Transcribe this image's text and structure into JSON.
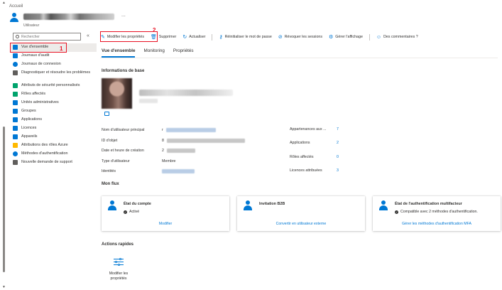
{
  "breadcrumb": "Accueil",
  "header": {
    "subtitle": "Utilisateur",
    "more": "..."
  },
  "search": {
    "placeholder": "Rechercher",
    "collapse": "«"
  },
  "sidebar": {
    "items": [
      {
        "label": "Vue d'ensemble",
        "color": "#0078d4"
      },
      {
        "label": "Journaux d'audit",
        "color": "#0078d4"
      },
      {
        "label": "Journaux de connexion",
        "color": "#0078d4"
      },
      {
        "label": "Diagnostiquer et résoudre les problèmes",
        "color": "#0078d4"
      },
      {
        "label": "Attributs de sécurité personnalisés",
        "color": "#0078d4"
      },
      {
        "label": "Rôles affectés",
        "color": "#0078d4"
      },
      {
        "label": "Unités administratives",
        "color": "#0078d4"
      },
      {
        "label": "Groupes",
        "color": "#0078d4"
      },
      {
        "label": "Applications",
        "color": "#0078d4"
      },
      {
        "label": "Licences",
        "color": "#0078d4"
      },
      {
        "label": "Appareils",
        "color": "#0078d4"
      },
      {
        "label": "Attributions des rôles Azure",
        "color": "#ffb900"
      },
      {
        "label": "Méthodes d'authentification",
        "color": "#0078d4"
      },
      {
        "label": "Nouvelle demande de support",
        "color": "#605e5c"
      }
    ]
  },
  "annotations": {
    "one": "1",
    "two": "2"
  },
  "toolbar": {
    "edit": "Modifier les propriétés",
    "delete": "Supprimer",
    "refresh": "Actualiser",
    "reset": "Réinitialiser le mot de passe",
    "revoke": "Révoquer les sessions",
    "view": "Gérer l'affichage",
    "feedback": "Des commentaires ?"
  },
  "tabs": [
    "Vue d'ensemble",
    "Monitoring",
    "Propriétés"
  ],
  "basic": {
    "title": "Informations de base"
  },
  "props": [
    {
      "key": "Nom d'utilisateur principal",
      "prefix": "r"
    },
    {
      "key": "ID d'objet",
      "prefix": "8"
    },
    {
      "key": "Date et heure de création",
      "prefix": "2"
    },
    {
      "key": "Type d'utilisateur",
      "value": "Membre"
    },
    {
      "key": "Identités",
      "prefix": ""
    }
  ],
  "stats": [
    {
      "key": "Appartenances aux ...",
      "value": "7"
    },
    {
      "key": "Applications",
      "value": "2"
    },
    {
      "key": "Rôles affectés",
      "value": "0"
    },
    {
      "key": "Licences attribuées",
      "value": "3"
    }
  ],
  "flux": {
    "title": "Mon flux"
  },
  "cards": [
    {
      "title": "État du compte",
      "status": "Activé",
      "link": "Modifier"
    },
    {
      "title": "Invitation B2B",
      "status": "",
      "link": "Convertir en utilisateur externe"
    },
    {
      "title": "État de l'authentification multifacteur",
      "status": "Compatible avec 2 méthodes d'authentification.",
      "link": "Gérer les méthodes d'authentification MFA"
    }
  ],
  "quick": {
    "title": "Actions rapides",
    "edit_label": "Modifier les propriétés"
  },
  "colors": {
    "accent": "#0078d4",
    "annotation": "#e81123"
  }
}
